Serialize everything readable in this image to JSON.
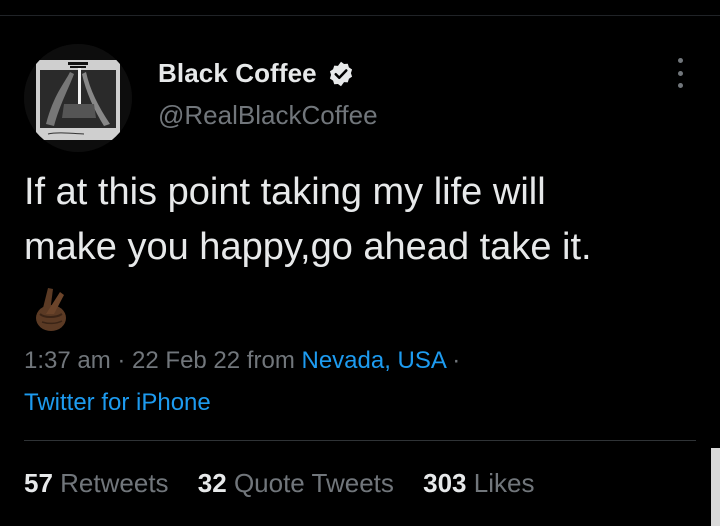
{
  "tweet": {
    "author_name": "Black Coffee",
    "handle": "@RealBlackCoffee",
    "text_line1": "If at this point taking my life will",
    "text_line2": "make you happy,go ahead take it.",
    "emoji": "crossed-fingers-emoji",
    "time": "1:37 am",
    "sep1": " · ",
    "date": "22 Feb 22",
    "from_word": " from ",
    "location": "Nevada, USA",
    "sep2": " ·",
    "source": "Twitter for iPhone",
    "stats": {
      "retweets_count": "57",
      "retweets_label": "Retweets",
      "quotes_count": "32",
      "quotes_label": "Quote Tweets",
      "likes_count": "303",
      "likes_label": "Likes"
    }
  },
  "icons": {
    "verified": "verified-badge-icon",
    "more": "more-options-icon"
  },
  "colors": {
    "background": "#000000",
    "text": "#e7e9ea",
    "muted": "#71767b",
    "link": "#1d9bf0"
  }
}
